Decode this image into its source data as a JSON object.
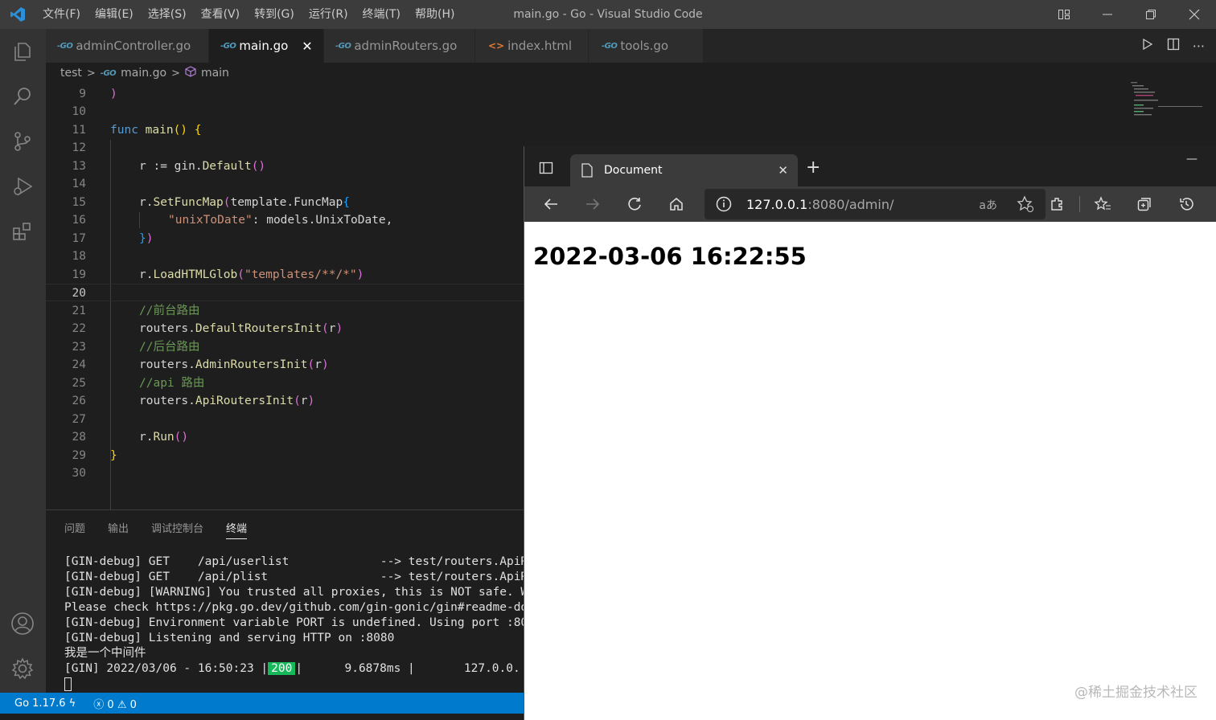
{
  "titlebar": {
    "menu": [
      "文件(F)",
      "编辑(E)",
      "选择(S)",
      "查看(V)",
      "转到(G)",
      "运行(R)",
      "终端(T)",
      "帮助(H)"
    ],
    "window_title": "main.go - Go - Visual Studio Code"
  },
  "tabs": [
    {
      "label": "adminController.go",
      "icon": "go-file-icon"
    },
    {
      "label": "main.go",
      "icon": "go-file-icon",
      "active": true
    },
    {
      "label": "adminRouters.go",
      "icon": "go-file-icon"
    },
    {
      "label": "index.html",
      "icon": "html-file-icon"
    },
    {
      "label": "tools.go",
      "icon": "go-file-icon"
    }
  ],
  "breadcrumb": {
    "folder": "test",
    "file": "main.go",
    "symbol": "main"
  },
  "editor": {
    "current_line": 20,
    "line_numbers": [
      "9",
      "10",
      "11",
      "12",
      "13",
      "14",
      "15",
      "16",
      "17",
      "18",
      "19",
      "20",
      "21",
      "22",
      "23",
      "24",
      "25",
      "26",
      "27",
      "28",
      "29",
      "30"
    ]
  },
  "code": {
    "l9": ")",
    "l11_kw": "func",
    "l11_fn": "main",
    "l11_paren": "()",
    "l11_brace": "{",
    "l13_a": "r := gin.",
    "l13_fn": "Default",
    "l13_p": "()",
    "l15_a": "r.",
    "l15_fn": "SetFuncMap",
    "l15_p": "(",
    "l15_b": "template.FuncMap",
    "l15_c": "{",
    "l16_str": "\"unixToDate\"",
    "l16_rest": ": models.UnixToDate,",
    "l17_c": "}",
    "l17_p": ")",
    "l19_a": "r.",
    "l19_fn": "LoadHTMLGlob",
    "l19_p": "(",
    "l19_str": "\"templates/**/*\"",
    "l19_pe": ")",
    "l21": "//前台路由",
    "l22_a": "routers.",
    "l22_fn": "DefaultRoutersInit",
    "l22_p": "(",
    "l22_r": "r",
    "l22_pe": ")",
    "l23": "//后台路由",
    "l24_a": "routers.",
    "l24_fn": "AdminRoutersInit",
    "l24_p": "(",
    "l24_r": "r",
    "l24_pe": ")",
    "l25": "//api 路由",
    "l26_a": "routers.",
    "l26_fn": "ApiRoutersInit",
    "l26_p": "(",
    "l26_r": "r",
    "l26_pe": ")",
    "l28_a": "r.",
    "l28_fn": "Run",
    "l28_p": "()",
    "l29": "}"
  },
  "panel": {
    "tabs": [
      "问题",
      "输出",
      "调试控制台",
      "终端"
    ],
    "active_tab": "终端",
    "terminal": [
      "[GIN-debug] GET    /api/userlist             --> test/routers.ApiR",
      "[GIN-debug] GET    /api/plist                --> test/routers.ApiR",
      "[GIN-debug] [WARNING] You trusted all proxies, this is NOT safe. W",
      "Please check https://pkg.go.dev/github.com/gin-gonic/gin#readme-do",
      "[GIN-debug] Environment variable PORT is undefined. Using port :80",
      "[GIN-debug] Listening and serving HTTP on :8080",
      "我是一个中间件"
    ],
    "gin_line": {
      "prefix": "[GIN] 2022/03/06 - 16:50:23 |",
      "status": "200",
      "rest": "|      9.6878ms |       127.0.0."
    }
  },
  "statusbar": {
    "go_version": "Go 1.17.6",
    "errors": "0",
    "warnings": "0"
  },
  "browser": {
    "tab_title": "Document",
    "url_host": "127.0.0.1",
    "url_rest": ":8080/admin/",
    "page_heading": "2022-03-06 16:22:55"
  },
  "watermark": "@稀土掘金技术社区",
  "colors": {
    "accent": "#007acc",
    "status_ok": "#16b85a"
  }
}
